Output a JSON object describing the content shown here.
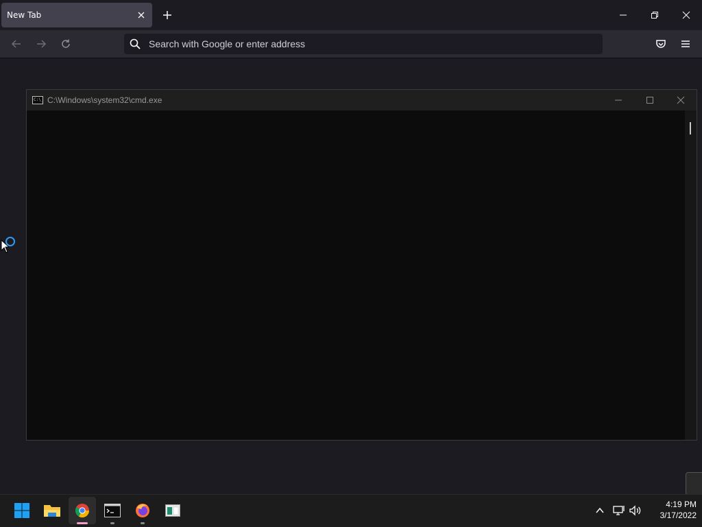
{
  "browser": {
    "tab": {
      "title": "New Tab"
    },
    "urlbar": {
      "placeholder": "Search with Google or enter address"
    }
  },
  "cmd_window": {
    "title": "C:\\Windows\\system32\\cmd.exe",
    "icon_text": "C:\\_"
  },
  "taskbar": {
    "items": [
      {
        "name": "start",
        "icon": "windows-logo-icon"
      },
      {
        "name": "file-explorer",
        "icon": "folder-icon"
      },
      {
        "name": "chrome",
        "icon": "chrome-icon"
      },
      {
        "name": "command-prompt",
        "icon": "terminal-icon"
      },
      {
        "name": "firefox",
        "icon": "firefox-icon"
      },
      {
        "name": "app",
        "icon": "window-app-icon"
      }
    ],
    "tray": {
      "time": "4:19 PM",
      "date": "3/17/2022"
    }
  },
  "colors": {
    "browser_bg": "#1c1b22",
    "toolbar_bg": "#2b2a33",
    "tab_active_bg": "#42414d",
    "cmd_bg": "#0c0c0c",
    "accent_blue": "#2e9bf0",
    "chrome_indicator": "#f0a0c8"
  }
}
